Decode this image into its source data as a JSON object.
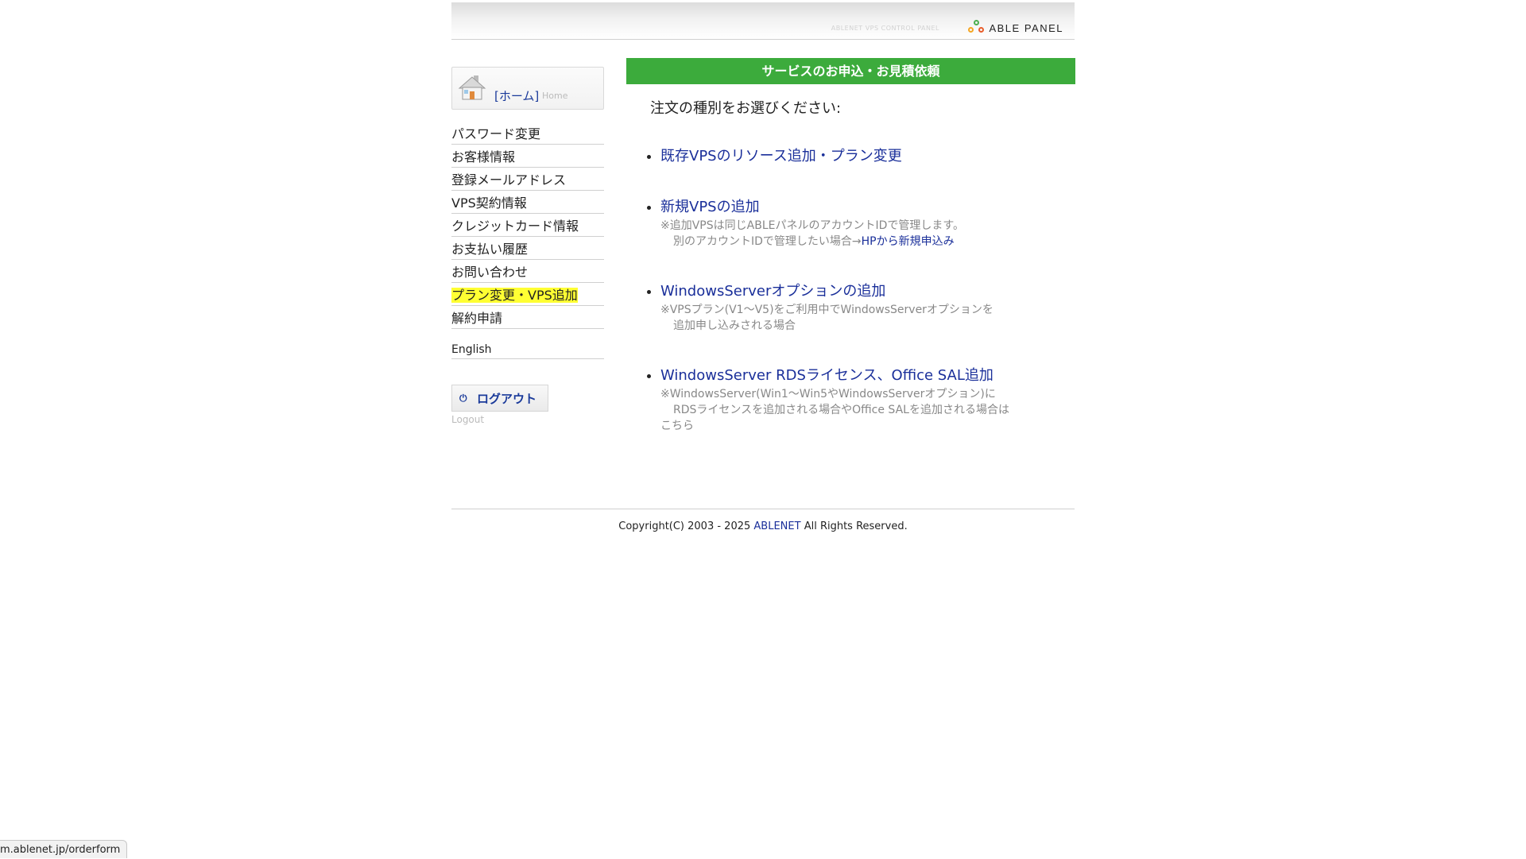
{
  "header": {
    "subtitle": "ABLENET VPS CONTROL PANEL",
    "logo_text": "ABLE PANEL",
    "logo_colors": [
      "#4caf50",
      "#f5a623",
      "#e85d2a"
    ]
  },
  "sidebar": {
    "home_label": "[ホーム]",
    "home_en": "Home",
    "items": [
      {
        "label": "パスワード変更"
      },
      {
        "label": "お客様情報"
      },
      {
        "label": "登録メールアドレス"
      },
      {
        "label": "VPS契約情報"
      },
      {
        "label": "クレジットカード情報"
      },
      {
        "label": "お支払い履歴"
      },
      {
        "label": "お問い合わせ"
      },
      {
        "label": "プラン変更・VPS追加"
      },
      {
        "label": "解約申請"
      }
    ],
    "language": "English",
    "logout_label": "ログアウト",
    "logout_en": "Logout"
  },
  "main": {
    "title": "サービスのお申込・お見積依頼",
    "prompt": "注文の種別をお選びください:",
    "options": [
      {
        "label": "既存VPSのリソース追加・プラン変更"
      },
      {
        "label": "新規VPSの追加",
        "note_line1": "※追加VPSは同じABLEパネルのアカウントIDで管理します。",
        "note_line2": "別のアカウントIDで管理したい場合→",
        "note_link": "HPから新規申込み"
      },
      {
        "label": "WindowsServerオプションの追加",
        "note_line1": "※VPSプラン(V1〜V5)をご利用中でWindowsServerオプションを",
        "note_line2": "追加申し込みされる場合"
      },
      {
        "label": "WindowsServer RDSライセンス、Office SAL追加",
        "note_line1": "※WindowsServer(Win1〜Win5やWindowsServerオプション)に",
        "note_line2": "RDSライセンスを追加される場合やOffice SALを追加される場合は",
        "note_line3": "こちら"
      }
    ],
    "accent_color": "#3cab3c"
  },
  "footer": {
    "copyright_prefix": "Copyright(C) 2003 - 2025 ",
    "brand": "ABLENET",
    "copyright_suffix": " All Rights Reserved."
  },
  "status_bar": {
    "url": "m.ablenet.jp/orderform"
  }
}
